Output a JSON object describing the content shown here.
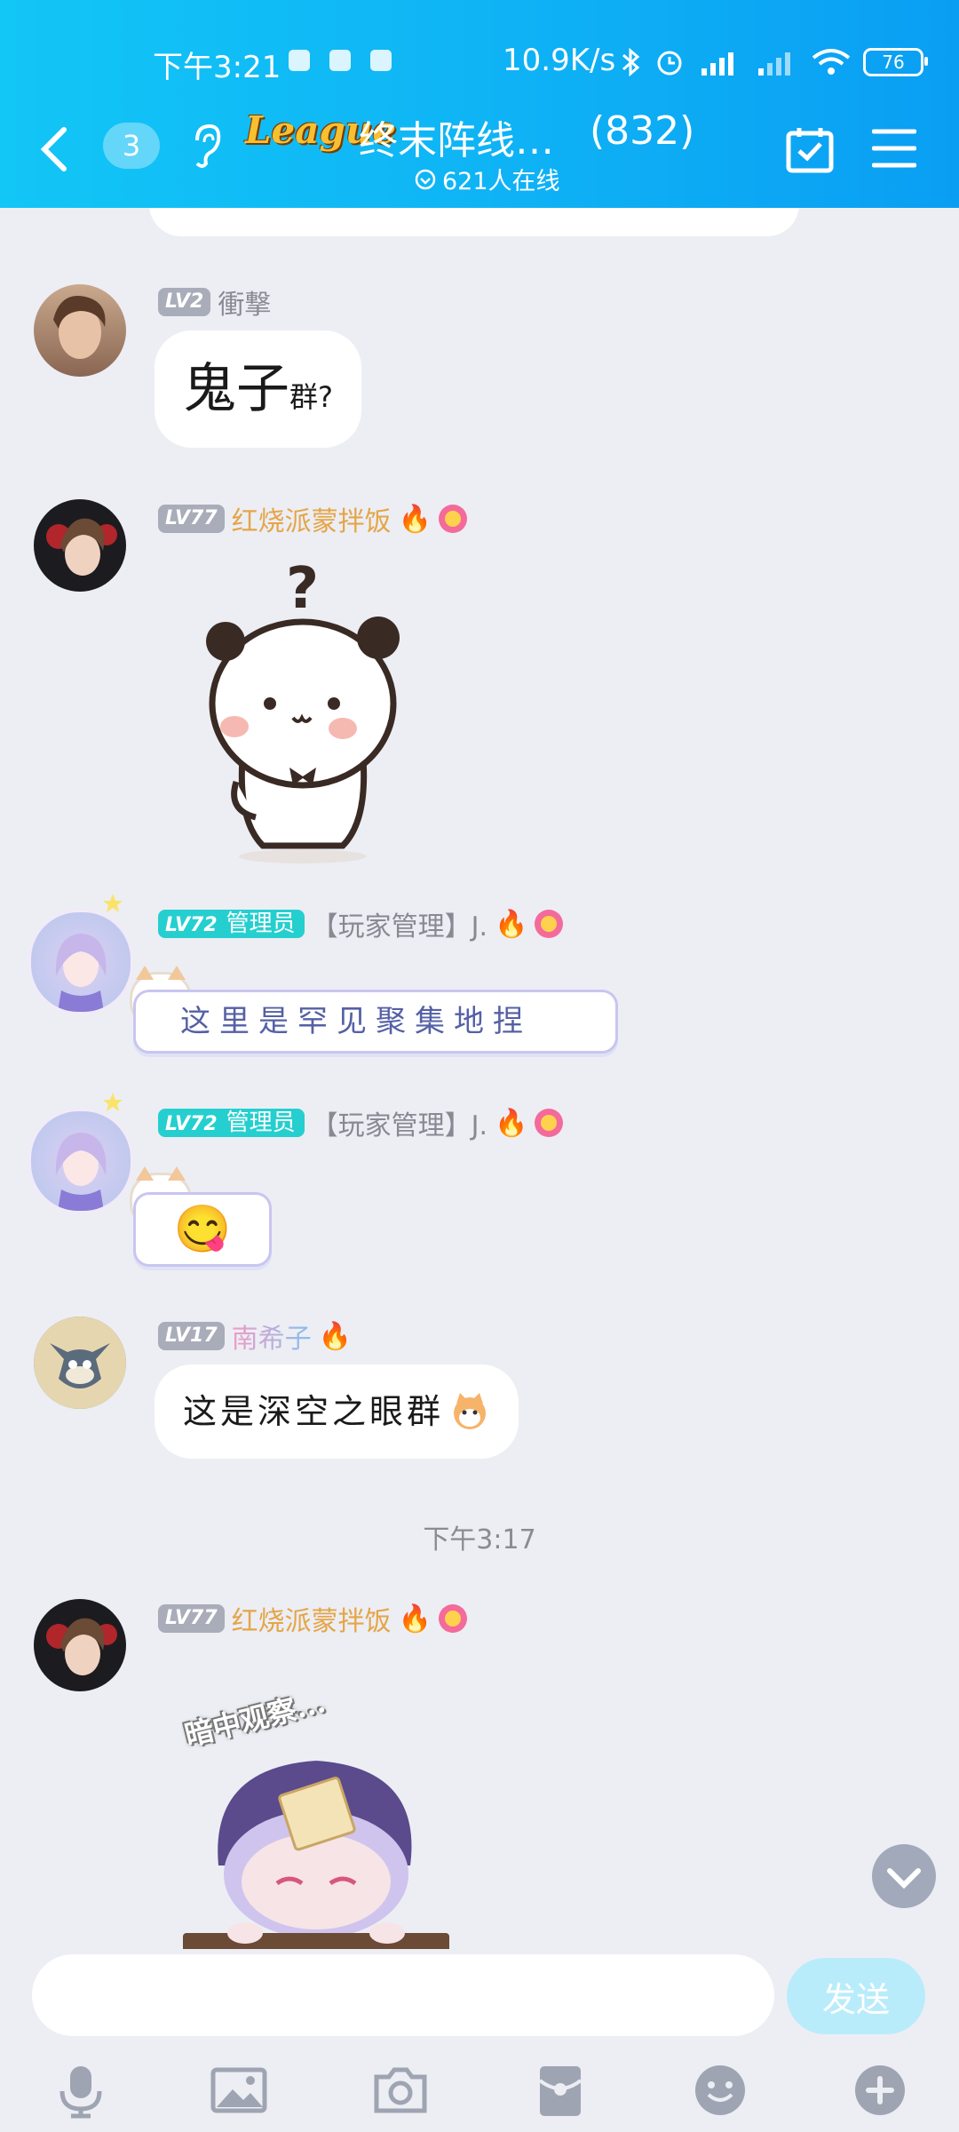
{
  "status_bar": {
    "time": "下午3:21",
    "speed": "10.9K/s",
    "battery": "76"
  },
  "header": {
    "unread_count": "3",
    "logo_text": "League",
    "group_name": "终末阵线…",
    "member_count": "(832)",
    "online": "621人在线"
  },
  "messages": [
    {
      "level": "LV2",
      "name": "衝撃",
      "text_big": "鬼子",
      "text_small": "群?"
    },
    {
      "level": "LV77",
      "name": "红烧派蒙拌饭",
      "sticker": "panda-question-sticker"
    },
    {
      "level": "LV72",
      "role": "管理员",
      "name": "【玩家管理】J.",
      "text": "这里是罕见聚集地捏"
    },
    {
      "level": "LV72",
      "role": "管理员",
      "name": "【玩家管理】J.",
      "emoji": "😋"
    },
    {
      "level": "LV17",
      "name": "南希子",
      "text": "这是深空之眼群"
    },
    {
      "timestamp": "下午3:17"
    },
    {
      "level": "LV77",
      "name": "红烧派蒙拌饭",
      "sticker_caption": "暗中观察..."
    }
  ],
  "input": {
    "placeholder": "",
    "send_label": "发送"
  },
  "toolbar": [
    "microphone-icon",
    "image-icon",
    "camera-icon",
    "red-packet-icon",
    "emoji-icon",
    "plus-icon"
  ],
  "colors": {
    "header_start": "#12c6f6",
    "header_end": "#0a9ef3",
    "admin_badge": "#25cfcf",
    "name_gold": "#e5a547",
    "send_disabled": "#b9ecfb"
  }
}
